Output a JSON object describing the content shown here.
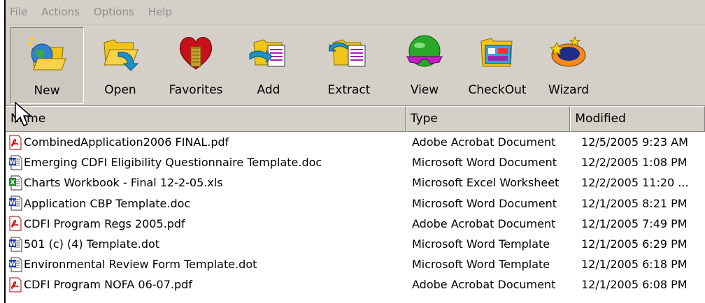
{
  "menu": [
    "File",
    "Actions",
    "Options",
    "Help"
  ],
  "toolbar": [
    {
      "label": "New",
      "icon": "new-globe-folder-icon"
    },
    {
      "label": "Open",
      "icon": "open-folder-arrow-icon"
    },
    {
      "label": "Favorites",
      "icon": "favorites-heart-icon"
    },
    {
      "label": "Add",
      "icon": "add-folder-icon"
    },
    {
      "label": "Extract",
      "icon": "extract-folder-icon"
    },
    {
      "label": "View",
      "icon": "view-sunglasses-icon"
    },
    {
      "label": "CheckOut",
      "icon": "checkout-box-icon"
    },
    {
      "label": "Wizard",
      "icon": "wizard-icon"
    }
  ],
  "columns": [
    "Name",
    "Type",
    "Modified"
  ],
  "files": [
    {
      "name": "CombinedApplication2006 FINAL.pdf",
      "type": "Adobe Acrobat Document",
      "modified": "12/5/2005 9:23 AM",
      "icon": "pdf"
    },
    {
      "name": "Emerging CDFI Eligibility Questionnaire Template.doc",
      "type": "Microsoft Word Document",
      "modified": "12/2/2005 1:08 PM",
      "icon": "word"
    },
    {
      "name": "Charts Workbook - Final 12-2-05.xls",
      "type": "Microsoft Excel Worksheet",
      "modified": "12/2/2005 11:20 ...",
      "icon": "excel"
    },
    {
      "name": "Application CBP Template.doc",
      "type": "Microsoft Word Document",
      "modified": "12/1/2005 8:21 PM",
      "icon": "word"
    },
    {
      "name": "CDFI Program Regs 2005.pdf",
      "type": "Adobe Acrobat Document",
      "modified": "12/1/2005 7:49 PM",
      "icon": "pdf"
    },
    {
      "name": "501 (c) (4) Template.dot",
      "type": "Microsoft Word Template",
      "modified": "12/1/2005 6:29 PM",
      "icon": "word"
    },
    {
      "name": "Environmental Review Form Template.dot",
      "type": "Microsoft Word Template",
      "modified": "12/1/2005 6:18 PM",
      "icon": "word"
    },
    {
      "name": "CDFI Program NOFA 06-07.pdf",
      "type": "Adobe Acrobat Document",
      "modified": "12/1/2005 6:08 PM",
      "icon": "pdf"
    }
  ]
}
